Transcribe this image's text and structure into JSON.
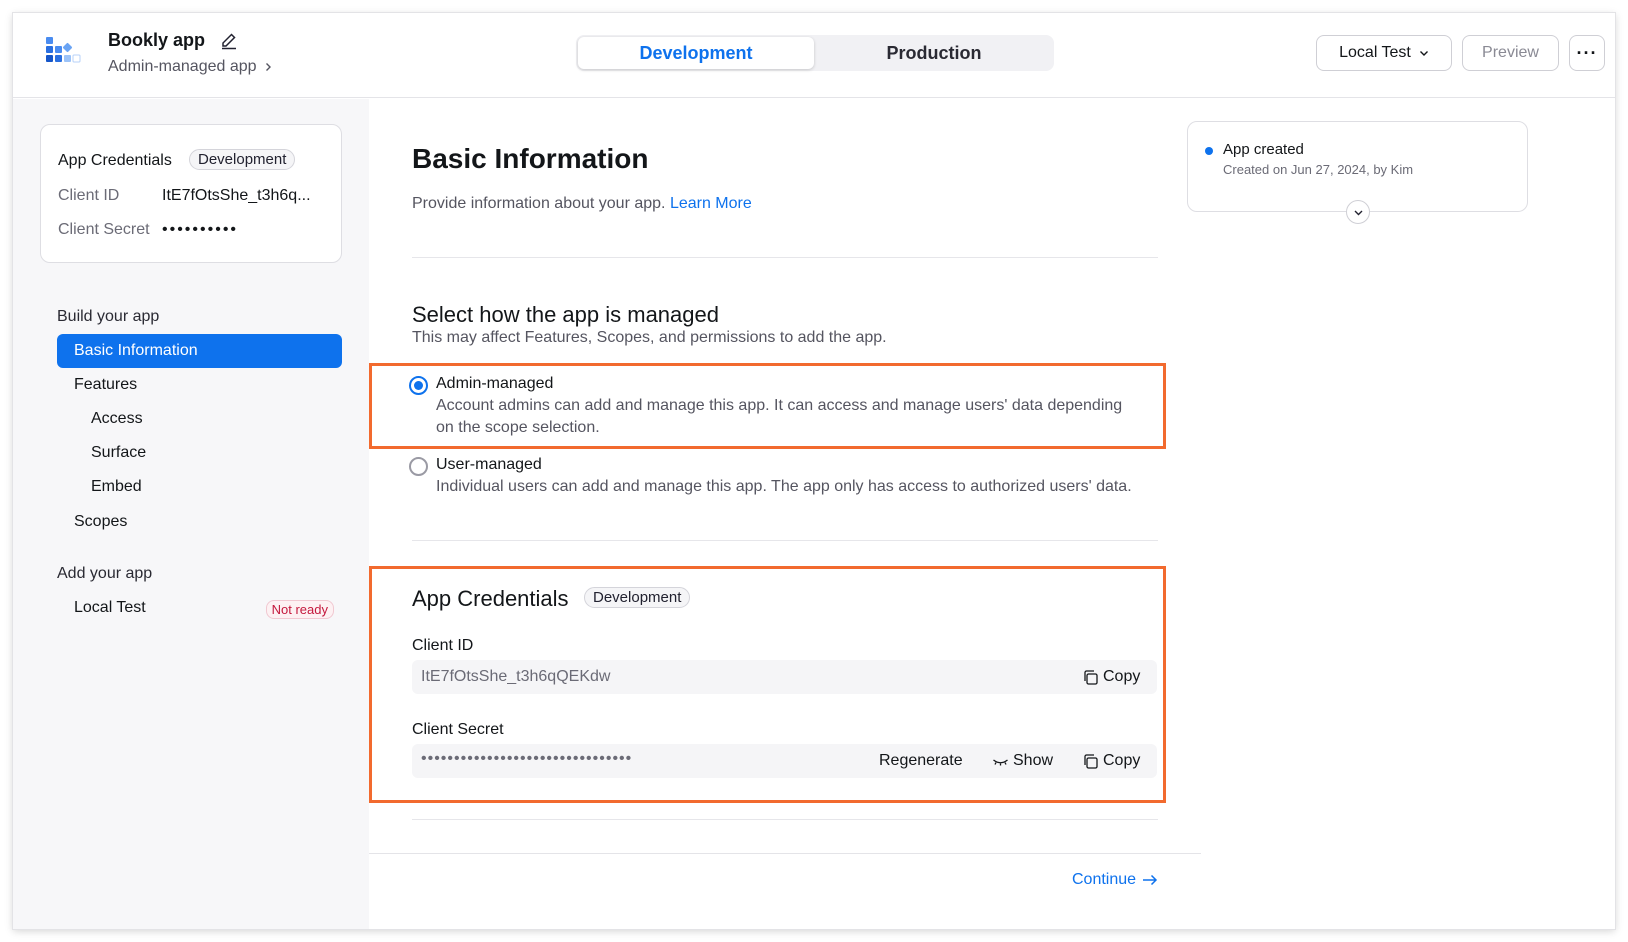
{
  "header": {
    "app_name": "Bookly app",
    "app_subtitle": "Admin-managed app",
    "tabs": [
      {
        "label": "Development",
        "active": true
      },
      {
        "label": "Production",
        "active": false
      }
    ],
    "local_test_label": "Local Test",
    "preview_label": "Preview",
    "more_label": "···"
  },
  "sidebar": {
    "credentials_card": {
      "title": "App Credentials",
      "badge": "Development",
      "client_id_label": "Client ID",
      "client_id_value": "ItE7fOtsShe_t3h6q...",
      "client_secret_label": "Client Secret",
      "client_secret_value": "••••••••••"
    },
    "build_section": "Build your app",
    "nav": [
      {
        "label": "Basic Information",
        "active": true
      },
      {
        "label": "Features"
      },
      {
        "label": "Access"
      },
      {
        "label": "Surface"
      },
      {
        "label": "Embed"
      },
      {
        "label": "Scopes"
      }
    ],
    "add_section": "Add your app",
    "local_test": {
      "label": "Local Test",
      "status": "Not ready"
    }
  },
  "main": {
    "title": "Basic Information",
    "description": "Provide information about your app.",
    "learn_more": "Learn More",
    "manage_title": "Select how the app is managed",
    "manage_subtitle": "This may affect Features, Scopes, and permissions to add the app.",
    "options": [
      {
        "title": "Admin-managed",
        "desc": "Account admins can add and manage this app. It can access and manage users' data depending on the scope selection.",
        "checked": true
      },
      {
        "title": "User-managed",
        "desc": "Individual users can add and manage this app. The app only has access to authorized users' data.",
        "checked": false
      }
    ],
    "credentials": {
      "title": "App Credentials",
      "badge": "Development",
      "client_id_label": "Client ID",
      "client_id_value": "ItE7fOtsShe_t3h6qQEKdw",
      "copy_label": "Copy",
      "client_secret_label": "Client Secret",
      "client_secret_value": "••••••••••••••••••••••••••••••••",
      "regenerate_label": "Regenerate",
      "show_label": "Show"
    },
    "continue_label": "Continue"
  },
  "activity": {
    "title": "App created",
    "subtitle": "Created on Jun 27, 2024, by Kim"
  },
  "colors": {
    "accent": "#0e72ed",
    "highlight": "#f26a2e",
    "danger": "#c4183d"
  }
}
